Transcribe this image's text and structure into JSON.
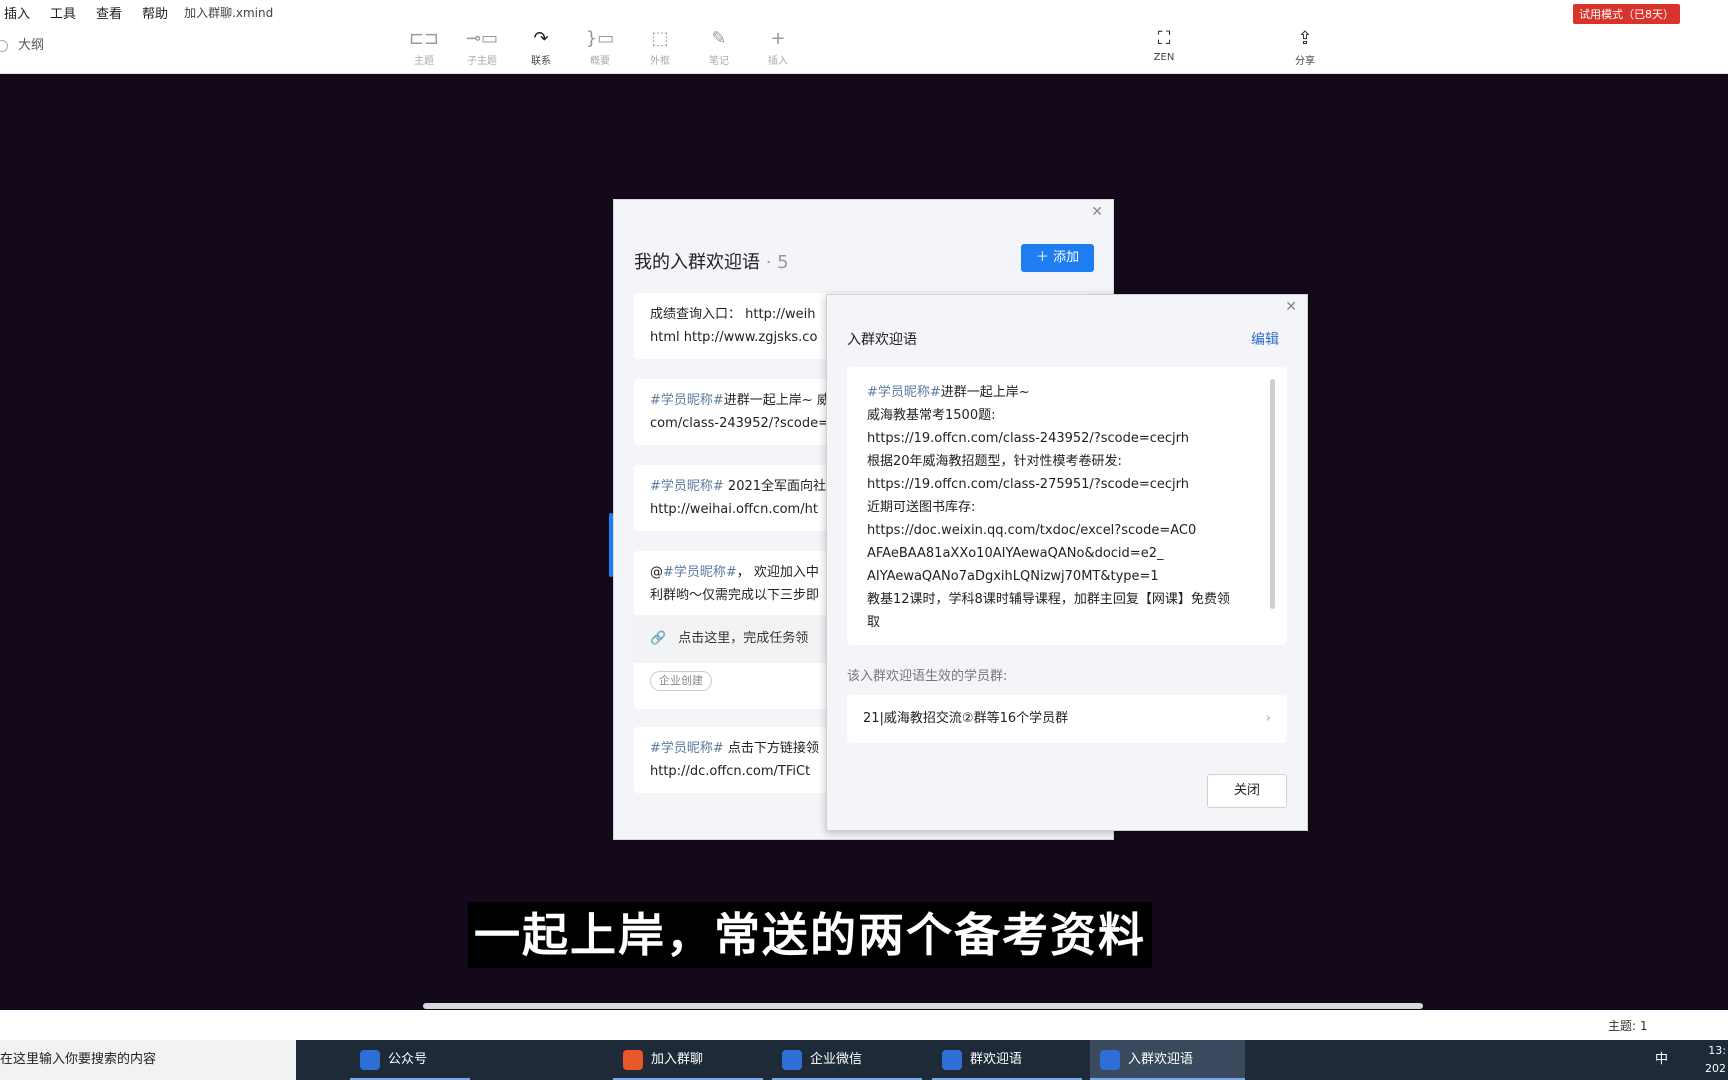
{
  "menubar": {
    "items": [
      "插入",
      "工具",
      "查看",
      "帮助"
    ],
    "file_name": "加入群聊.xmind",
    "trial_badge": "试用模式（已8天）"
  },
  "toolbar": {
    "outline_tab": "大纲",
    "tools": [
      {
        "label": "主题",
        "icon": "topic-icon"
      },
      {
        "label": "子主题",
        "icon": "subtopic-icon"
      },
      {
        "label": "联系",
        "icon": "relationship-icon"
      },
      {
        "label": "概要",
        "icon": "summary-icon"
      },
      {
        "label": "外框",
        "icon": "boundary-icon"
      },
      {
        "label": "笔记",
        "icon": "note-icon"
      },
      {
        "label": "插入",
        "icon": "plus-icon"
      }
    ],
    "zen_label": "ZEN",
    "share_label": "分享"
  },
  "main_dialog": {
    "title": "我的入群欢迎语",
    "count": "· 5",
    "add_button": "添加",
    "messages": [
      {
        "line1": "成绩查询入口： http://weih",
        "line2": "html  http://www.zgjsks.co"
      },
      {
        "tag": "#学员昵称#",
        "line1_rest": "进群一起上岸~ 威",
        "line2": "com/class-243952/?scode="
      },
      {
        "tag": "#学员昵称#",
        "line1_rest": " 2021全军面向社",
        "line2": "http://weihai.offcn.com/ht"
      },
      {
        "prefix": "@",
        "tag": "#学员昵称#",
        "line1_rest": "， 欢迎加入中",
        "line2": "利群哟～仅需完成以下三步即",
        "link_text": "点击这里，完成任务领",
        "chip": "企业创建"
      },
      {
        "tag": "#学员昵称#",
        "line1_rest": " 点击下方链接领",
        "line2": "http://dc.offcn.com/TFiCt"
      }
    ]
  },
  "sub_dialog": {
    "title": "入群欢迎语",
    "edit": "编辑",
    "content_tag": "#学员昵称#",
    "content_first_rest": "进群一起上岸~",
    "content_lines": [
      "威海教基常考1500题:",
      "https://19.offcn.com/class-243952/?scode=cecjrh",
      "根据20年威海教招题型，针对性模考卷研发:",
      "https://19.offcn.com/class-275951/?scode=cecjrh",
      "近期可送图书库存:",
      "https://doc.weixin.qq.com/txdoc/excel?scode=AC0",
      "AFAeBAA81aXXo10AIYAewaQANo&docid=e2_",
      "AIYAewaQANo7aDgxihLQNizwj70MT&type=1",
      "教基12课时，学科8课时辅导课程，加群主回复【网课】免费领",
      "取"
    ],
    "groups_label": "该入群欢迎语生效的学员群:",
    "groups_value": "21|威海教招交流②群等16个学员群",
    "close_button": "关闭"
  },
  "subtitle": "一起上岸，常送的两个备考资料",
  "statusbar": {
    "theme": "主题: 1"
  },
  "taskbar": {
    "search_placeholder": "在这里输入你要搜索的内容",
    "tasks": [
      {
        "label": "公众号",
        "color": "#2d6fd6"
      },
      {
        "label": "加入群聊",
        "color": "#e8572a"
      },
      {
        "label": "企业微信",
        "color": "#2d6fd6"
      },
      {
        "label": "群欢迎语",
        "color": "#2d6fd6"
      },
      {
        "label": "入群欢迎语",
        "color": "#2d6fd6"
      }
    ],
    "ime": "中",
    "clock_time": "13:",
    "clock_date": "202"
  }
}
